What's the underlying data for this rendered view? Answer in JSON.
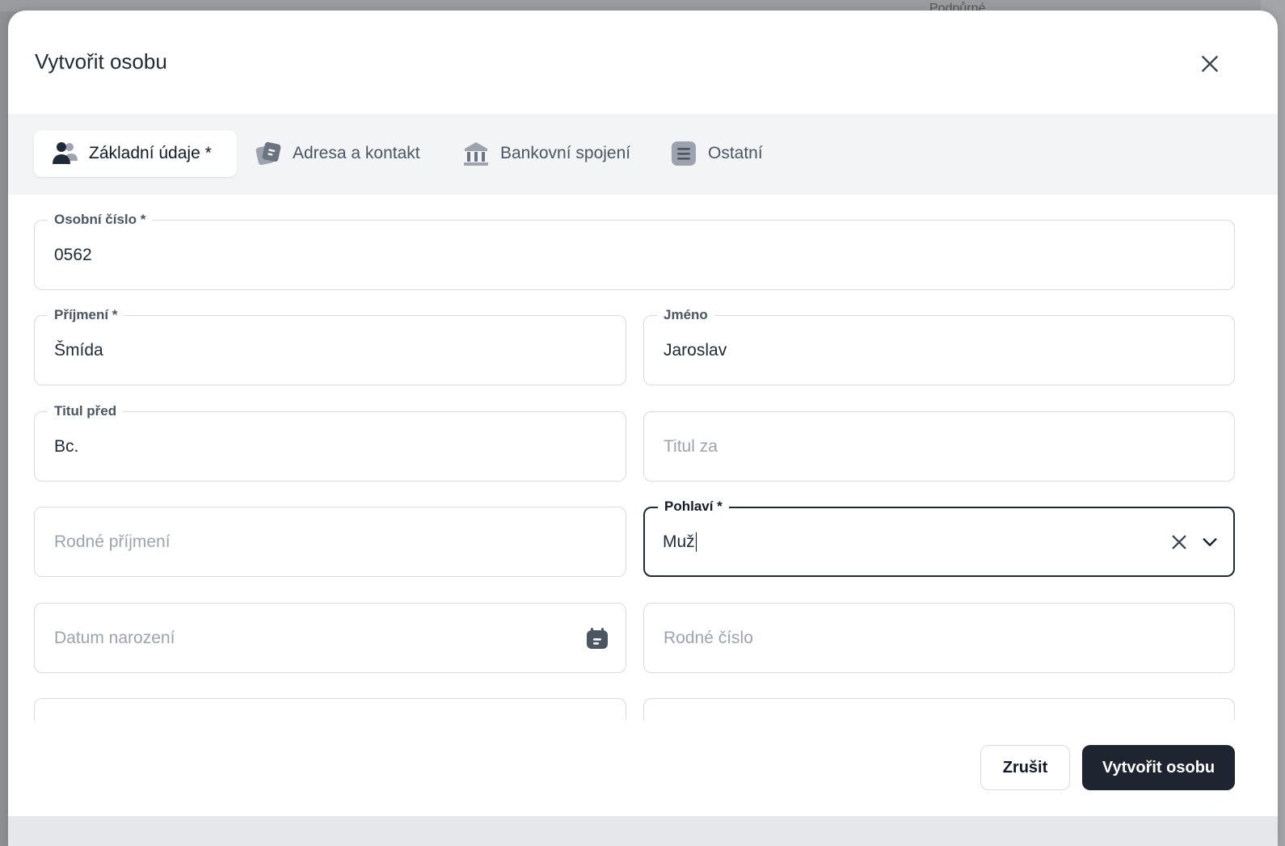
{
  "background": {
    "peek_text": "Podpůrné"
  },
  "modal": {
    "title": "Vytvořit osobu",
    "tabs": [
      {
        "label": "Základní údaje *",
        "icon": "user-icon",
        "active": true
      },
      {
        "label": "Adresa a kontakt",
        "icon": "contact-card-icon",
        "active": false
      },
      {
        "label": "Bankovní spojení",
        "icon": "bank-icon",
        "active": false
      },
      {
        "label": "Ostatní",
        "icon": "list-icon",
        "active": false
      }
    ],
    "form": {
      "osobni_cislo": {
        "label": "Osobní číslo *",
        "value": "0562"
      },
      "prijmeni": {
        "label": "Příjmení *",
        "value": "Šmída"
      },
      "jmeno": {
        "label": "Jméno",
        "value": "Jaroslav"
      },
      "titul_pred": {
        "label": "Titul před",
        "value": "Bc."
      },
      "titul_za": {
        "placeholder": "Titul za"
      },
      "rodne_prijmeni": {
        "placeholder": "Rodné příjmení"
      },
      "pohlavi": {
        "label": "Pohlaví *",
        "value": "Muž"
      },
      "datum_narozeni": {
        "placeholder": "Datum narození"
      },
      "rodne_cislo": {
        "placeholder": "Rodné číslo"
      }
    },
    "buttons": {
      "cancel": "Zrušit",
      "create": "Vytvořit osobu"
    }
  },
  "colors": {
    "accent": "#1f2530",
    "border": "#d7dbe0",
    "tab_bar": "#f3f4f6"
  }
}
